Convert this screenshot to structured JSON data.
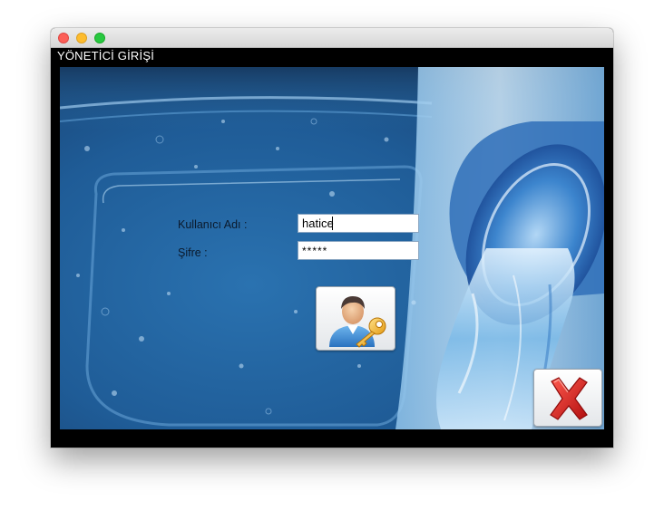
{
  "window": {
    "form_title": "YÖNETİCİ GİRİŞİ"
  },
  "login": {
    "username_label": "Kullanıcı Adı :",
    "username_value": "hatice",
    "password_label": "Şifre :",
    "password_value": "*****"
  },
  "buttons": {
    "login_icon": "user-key-icon",
    "close_icon": "red-x-icon"
  },
  "colors": {
    "close_red": "#d01a1a",
    "key_gold": "#f2b01e",
    "shirt_blue": "#3d8fd4"
  }
}
